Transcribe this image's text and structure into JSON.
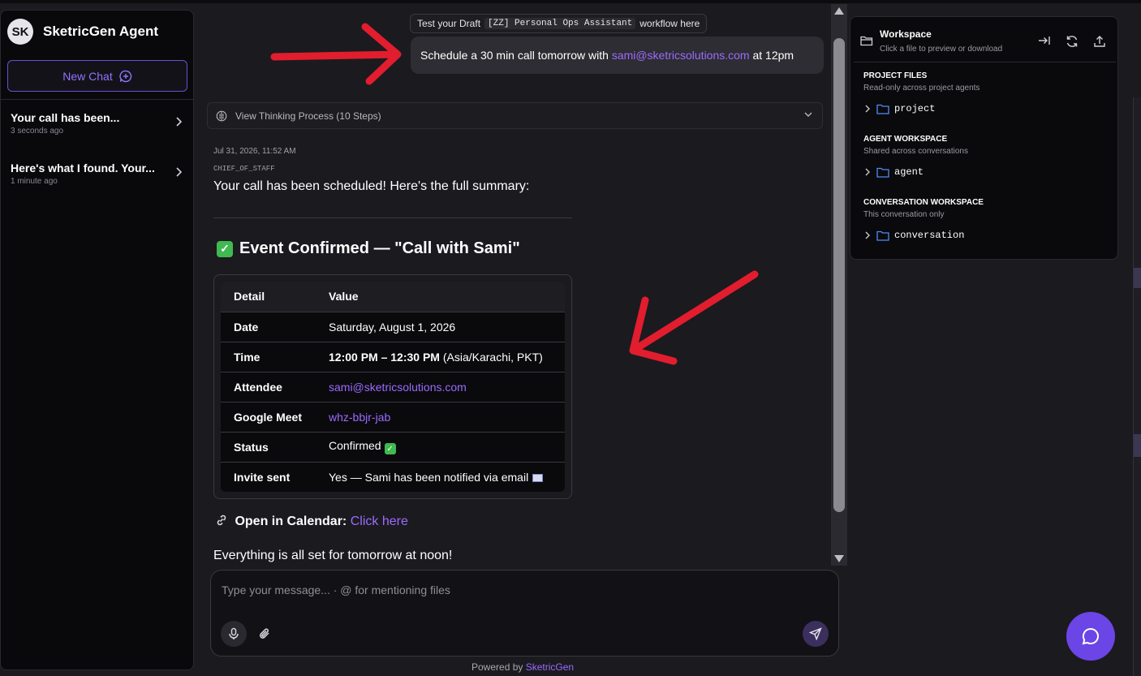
{
  "sidebar": {
    "avatar_initials": "SK",
    "brand": "SketricGen Agent",
    "new_chat_label": "New Chat",
    "chats": [
      {
        "title": "Your call has been...",
        "time": "3 seconds ago"
      },
      {
        "title": "Here's what I found. Your...",
        "time": "1 minute ago"
      }
    ]
  },
  "main": {
    "draft_prefix": "Test your Draft",
    "draft_code": "[ZZ] Personal Ops Assistant",
    "draft_suffix": "workflow here",
    "user_message_prefix": "Schedule a 30 min call tomorrow with",
    "user_message_email": "sami@sketricsolutions.com",
    "user_message_suffix": "at 12pm",
    "thinking_label": "View Thinking Process (10 Steps)",
    "timestamp": "Jul 31, 2026, 11:52 AM",
    "agent_name": "CHIEF_OF_STAFF",
    "summary_text": "Your call has been scheduled! Here's the full summary:",
    "event_heading": "Event Confirmed — \"Call with Sami\"",
    "table": {
      "headers": [
        "Detail",
        "Value"
      ],
      "rows": [
        {
          "key": "Date",
          "value": "Saturday, August 1, 2026"
        },
        {
          "key": "Time",
          "value_bold": "12:00 PM – 12:30 PM",
          "value": "(Asia/Karachi, PKT)"
        },
        {
          "key": "Attendee",
          "value": "sami@sketricsolutions.com"
        },
        {
          "key": "Google Meet",
          "value": "whz-bbjr-jab"
        },
        {
          "key": "Status",
          "value": "Confirmed"
        },
        {
          "key": "Invite sent",
          "value": "Yes — Sami has been notified via email"
        }
      ]
    },
    "calendar_label": "Open in Calendar:",
    "calendar_link": "Click here",
    "final_text": "Everything is all set for tomorrow at noon!"
  },
  "input": {
    "placeholder": "Type your message... · @ for mentioning files"
  },
  "footer": {
    "powered_prefix": "Powered by",
    "powered_brand": "SketricGen"
  },
  "workspace": {
    "title": "Workspace",
    "subtitle": "Click a file to preview or download",
    "sections": [
      {
        "title": "PROJECT FILES",
        "subtitle": "Read-only across project agents",
        "folder": "project"
      },
      {
        "title": "AGENT WORKSPACE",
        "subtitle": "Shared across conversations",
        "folder": "agent"
      },
      {
        "title": "CONVERSATION WORKSPACE",
        "subtitle": "This conversation only",
        "folder": "conversation"
      }
    ]
  },
  "colors": {
    "accent": "#6c45e6",
    "link": "#9b6bff",
    "background": "#1b1a1f",
    "success": "#3fb950"
  },
  "icons": [
    "plus-chat-icon",
    "chevron-right-icon",
    "brain-icon",
    "chevron-down-icon",
    "folder-icon",
    "collapse-panel-icon",
    "refresh-icon",
    "upload-icon",
    "mic-icon",
    "paperclip-icon",
    "send-icon",
    "chat-bubble-icon",
    "link-icon",
    "check-icon",
    "envelope-icon"
  ]
}
